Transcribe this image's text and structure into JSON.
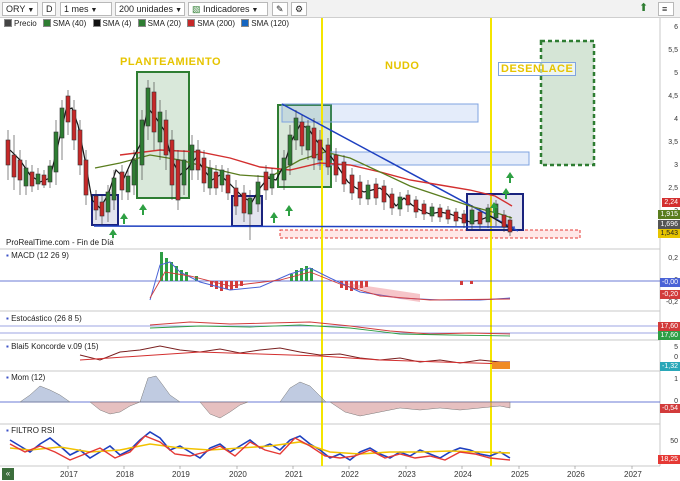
{
  "toolbar": {
    "ticker": "ORY",
    "period_short": "D",
    "interval": "1 mes",
    "units": "200 unidades",
    "indicators": "Indicadores"
  },
  "legend": {
    "items": [
      {
        "label": "Precio",
        "color": "#444444"
      },
      {
        "label": "SMA (40)",
        "color": "#2e7d32"
      },
      {
        "label": "SMA (4)",
        "color": "#111111"
      },
      {
        "label": "SMA (20)",
        "color": "#2e7d32"
      },
      {
        "label": "SMA (200)",
        "color": "#c62828"
      },
      {
        "label": "SMA (120)",
        "color": "#1565c0"
      }
    ]
  },
  "annotations": {
    "planteamiento": "PLANTEAMIENTO",
    "nudo": "NUDO",
    "desenlace": "DESENLACE"
  },
  "source_label": "ProRealTime.com - Fin de Día",
  "price_axis": [
    "6",
    "5,5",
    "5",
    "4,5",
    "4",
    "3,5",
    "3",
    "2,5",
    "2"
  ],
  "price_tags": [
    "2,24",
    "1,915",
    "1,696",
    "1,543"
  ],
  "panels": {
    "macd": {
      "label": "MACD (12 26 9)",
      "ticks": [
        "0,2",
        "0",
        "-0,2"
      ],
      "tags": [
        "-0,00",
        "-0,20",
        "-0,20"
      ]
    },
    "stoch": {
      "label": "Estocástico (26 8 5)",
      "tags": [
        "17,60",
        "17,60"
      ]
    },
    "blai5": {
      "label": "Blai5 Koncorde v.09 (15)",
      "ticks": [
        "5",
        "0"
      ],
      "tags": [
        "-1,32"
      ]
    },
    "mom": {
      "label": "Mom (12)",
      "ticks": [
        "1",
        "0"
      ],
      "tags": [
        "-0,54"
      ]
    },
    "rsi": {
      "label": "FILTRO RSI",
      "ticks": [
        "50"
      ],
      "tags": [
        "18,25"
      ]
    }
  },
  "x_axis": [
    "2017",
    "2018",
    "2019",
    "2020",
    "2021",
    "2022",
    "2023",
    "2024",
    "2025",
    "2026",
    "2027"
  ],
  "colors": {
    "annotation_yellow": "#f4d400",
    "box_green": "#2e7d32",
    "box_navy": "#1a237e",
    "trend_blue": "#1e40c0",
    "sma_red": "#d32f2f",
    "sma_green": "#5a7d1e"
  }
}
